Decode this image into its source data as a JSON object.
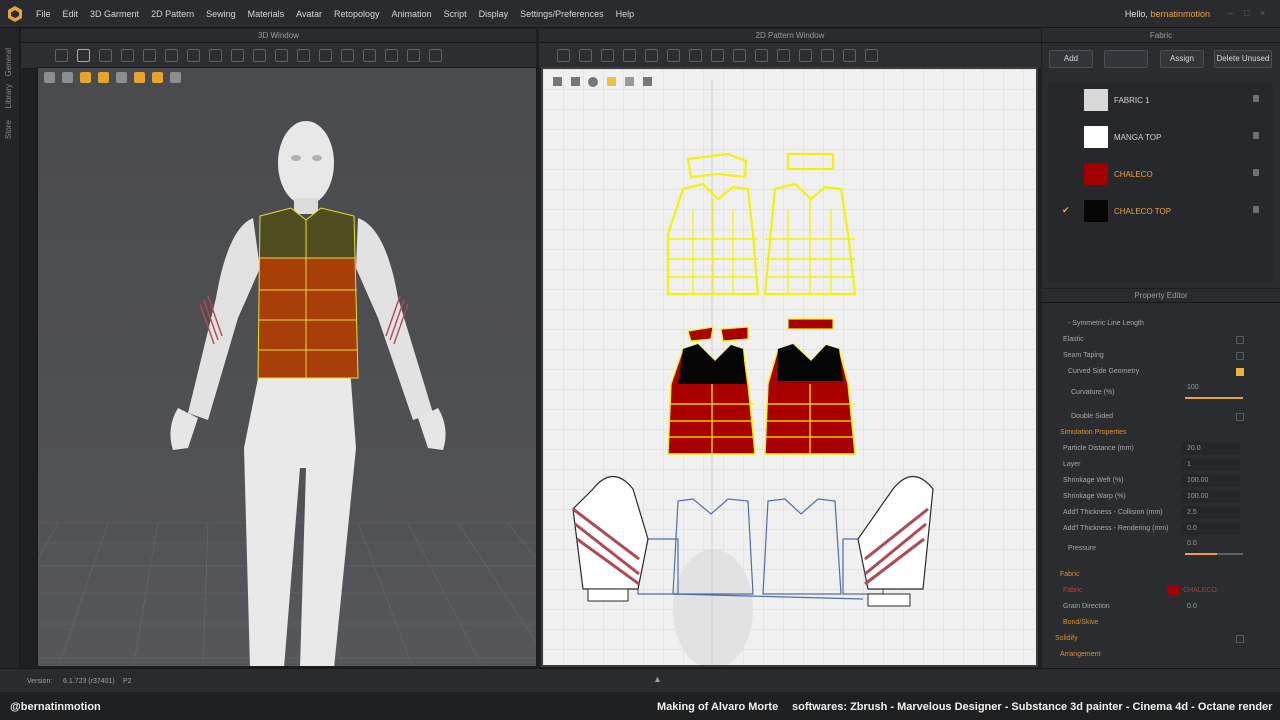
{
  "menu": {
    "items": [
      "File",
      "Edit",
      "3D Garment",
      "2D Pattern",
      "Sewing",
      "Materials",
      "Avatar",
      "Retopology",
      "Animation",
      "Script",
      "Display",
      "Settings/Preferences",
      "Help"
    ],
    "greeting": "Hello,",
    "username": "bernatinmotion"
  },
  "sidebar": {
    "tabs": [
      "General",
      "Library",
      "Store"
    ]
  },
  "windows": {
    "view3d_title": "3D Window",
    "view2d_title": "2D Pattern Window",
    "fabric_title": "Fabric",
    "property_title": "Property Editor"
  },
  "fabric": {
    "buttons": {
      "add": "Add",
      "assign": "Assign",
      "delete_unused": "Delete Unused"
    },
    "items": [
      {
        "name": "FABRIC 1",
        "color": "#d8d8d8",
        "selected": false
      },
      {
        "name": "MANGA TOP",
        "color": "#ffffff",
        "selected": false
      },
      {
        "name": "CHALECO",
        "color": "#a00000",
        "selected": false
      },
      {
        "name": "CHALECO TOP",
        "color": "#050505",
        "selected": true
      }
    ]
  },
  "property": {
    "rows": [
      {
        "label": "- Symmetric Line Length",
        "value": ""
      },
      {
        "label": "Elastic",
        "value": ""
      },
      {
        "label": "Seam Taping",
        "value": ""
      },
      {
        "label": "Curved Side Geometry",
        "value": ""
      },
      {
        "label": "Curvature (%)",
        "value": "100"
      },
      {
        "label": "Double Sided",
        "value": ""
      },
      {
        "label": "Simulation Properties",
        "value": ""
      },
      {
        "label": "Particle Distance (mm)",
        "value": "20.0"
      },
      {
        "label": "Layer",
        "value": "1"
      },
      {
        "label": "Shrinkage Weft (%)",
        "value": "100.00"
      },
      {
        "label": "Shrinkage Warp (%)",
        "value": "100.00"
      },
      {
        "label": "Add'l Thickness - Collision (mm)",
        "value": "2.5"
      },
      {
        "label": "Add'l Thickness - Rendering (mm)",
        "value": "0.0"
      },
      {
        "label": "Pressure",
        "value": "0.0"
      },
      {
        "label": "Fabric",
        "value": ""
      },
      {
        "label": "Fabric",
        "value": "CHALECO"
      },
      {
        "label": "Grain Direction",
        "value": "0.0"
      },
      {
        "label": "Bond/Skive",
        "value": ""
      },
      {
        "label": "Solidify",
        "value": ""
      },
      {
        "label": "Arrangement",
        "value": ""
      }
    ],
    "curved_side_checked": true,
    "curvature_level": 1.0,
    "pressure_level": 0.55
  },
  "status": {
    "version_label": "Version:",
    "version_value": "6.1.723 (r37401)",
    "extra": "P2"
  },
  "footer": {
    "handle": "@bernatinmotion",
    "making": "Making of Alvaro Morte",
    "softwares": "softwares: Zbrush - Marvelous Designer - Substance 3d painter - Cinema 4d - Octane render"
  },
  "colors": {
    "accent": "#e8a33a",
    "vest_red": "#a81c08",
    "vest_top": "#4d4b1c",
    "pattern_yellow": "#f2f20c",
    "pattern_blue": "#4f6fa8"
  },
  "icons": [
    "app-logo-icon",
    "lock-icon",
    "check-icon",
    "expand-icon"
  ]
}
